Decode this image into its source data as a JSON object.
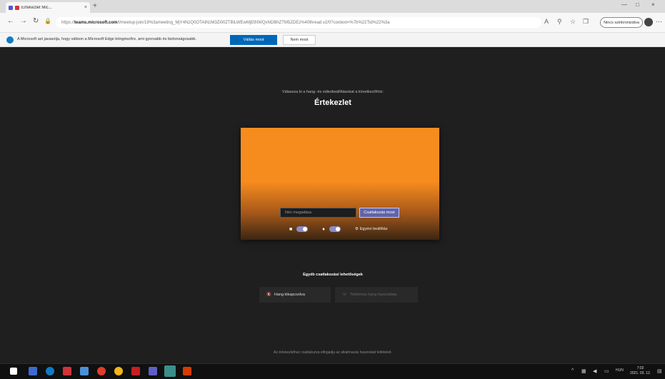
{
  "browser": {
    "tab_title": "Értekezlet Mic...",
    "tab_close": "×",
    "new_tab": "+",
    "minimize": "—",
    "maximize": "□",
    "close": "×",
    "url_prefix": "https://",
    "url_domain": "teams.microsoft.com",
    "url_rest": "/l/meetup-join/19%3ameeting_MjY4NzQ0OTAtNzM3Zi00ZTBiLWEwMjEtNWQxNDBhZTM5ZDEz%40thread.v2/0?context=%7b%22Tid%22%3a",
    "profile_label": "Nincs szinkronizálva",
    "infobar_text": "A Microsoft azt javasolja, hogy váltson a Microsoft Edge böngészőre, ami gyorsabb és biztonságosabb.",
    "infobar_primary": "Váltás most",
    "infobar_secondary": "Nem most"
  },
  "meeting": {
    "subtitle": "Válassza ki a hang- és videobeállításokat a következőhöz:",
    "title": "Értekezlet",
    "name_placeholder": "Név megadása",
    "join_label": "Csatlakozás most",
    "settings_label": "Egyéni beállítás",
    "video_state": "on",
    "audio_state": "on"
  },
  "other_options": {
    "title": "Egyéb csatlakozási lehetőségek",
    "audio_off_label": "Hang kikapcsolva",
    "phone_audio_label": "Telefonos hang használata"
  },
  "footer": {
    "text": "Az értekezlethez csatlakozva elfogadja az alkalmazás használati feltételeit."
  },
  "taskbar": {
    "clock_time": "7:02",
    "clock_date": "2021. 03. 12.",
    "lang": "HUN"
  },
  "colors": {
    "accent": "#6264a7",
    "preview_orange": "#f78c1e",
    "background": "#1f1f1f"
  }
}
